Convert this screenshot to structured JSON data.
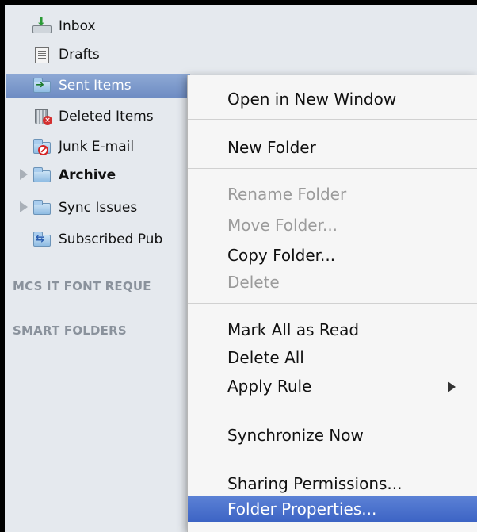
{
  "sidebar": {
    "folders": [
      {
        "label": "Inbox",
        "icon": "inbox-icon"
      },
      {
        "label": "Drafts",
        "icon": "drafts-icon"
      },
      {
        "label": "Sent Items",
        "icon": "sent-items-icon"
      },
      {
        "label": "Deleted Items",
        "icon": "deleted-items-icon"
      },
      {
        "label": "Junk E-mail",
        "icon": "junk-email-icon"
      },
      {
        "label": "Archive",
        "icon": "folder-icon"
      },
      {
        "label": "Sync Issues",
        "icon": "folder-icon"
      },
      {
        "label": "Subscribed Pub",
        "icon": "subscribed-folder-icon"
      }
    ],
    "sections": [
      {
        "label": "MCS IT FONT REQUE"
      },
      {
        "label": "SMART FOLDERS"
      }
    ]
  },
  "context_menu": {
    "items": [
      {
        "label": "Open in New Window",
        "enabled": true
      },
      {
        "label": "New Folder",
        "enabled": true
      },
      {
        "label": "Rename Folder",
        "enabled": false
      },
      {
        "label": "Move Folder...",
        "enabled": false
      },
      {
        "label": "Copy Folder...",
        "enabled": true
      },
      {
        "label": "Delete",
        "enabled": false
      },
      {
        "label": "Mark All as Read",
        "enabled": true
      },
      {
        "label": "Delete All",
        "enabled": true
      },
      {
        "label": "Apply Rule",
        "enabled": true,
        "submenu": true
      },
      {
        "label": "Synchronize Now",
        "enabled": true
      },
      {
        "label": "Sharing Permissions...",
        "enabled": true
      },
      {
        "label": "Folder Properties...",
        "enabled": true,
        "highlighted": true
      }
    ]
  },
  "colors": {
    "sidebar_bg": "#e5e9ee",
    "selection": "#7c99cc",
    "menu_highlight": "#4a72cd"
  }
}
